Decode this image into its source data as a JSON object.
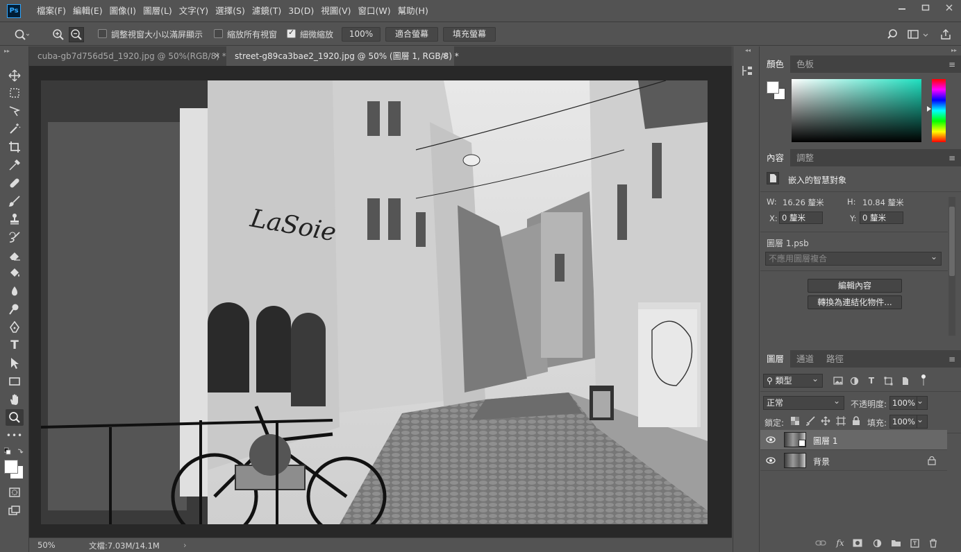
{
  "app": {
    "logo": "Ps"
  },
  "menu": [
    "檔案(F)",
    "編輯(E)",
    "圖像(I)",
    "圖層(L)",
    "文字(Y)",
    "選擇(S)",
    "濾鏡(T)",
    "3D(D)",
    "視圖(V)",
    "窗口(W)",
    "幫助(H)"
  ],
  "options": {
    "fit_window_label": "調整視窗大小以滿屏顯示",
    "zoom_all_label": "縮放所有視窗",
    "scrubby_label": "細微縮放",
    "zoom_value": "100%",
    "fit_screen_label": "適合螢幕",
    "fill_screen_label": "填充螢幕",
    "fit_window_checked": false,
    "zoom_all_checked": false,
    "scrubby_checked": true
  },
  "tabs": [
    {
      "title": "cuba-gb7d756d5d_1920.jpg @ 50%(RGB/8) *",
      "active": false
    },
    {
      "title": "street-g89ca3bae2_1920.jpg @ 50% (圖層 1, RGB/8) *",
      "active": true
    }
  ],
  "status": {
    "zoom": "50%",
    "doc_info": "文檔:7.03M/14.1M"
  },
  "color_panel": {
    "tabs": [
      "顏色",
      "色板"
    ],
    "active_tab": "顏色"
  },
  "properties_panel": {
    "tabs": [
      "內容",
      "調整"
    ],
    "active_tab": "內容",
    "type_label": "嵌入的智慧對象",
    "w_label": "W:",
    "w_value": "16.26 釐米",
    "h_label": "H:",
    "h_value": "10.84 釐米",
    "x_label": "X:",
    "x_value": "0 釐米",
    "y_label": "Y:",
    "y_value": "0 釐米",
    "file_name": "圖層 1.psb",
    "comp_select": "不應用圖層複合",
    "edit_contents": "編輯內容",
    "convert_linked": "轉換為連結化物件..."
  },
  "layers_panel": {
    "tabs": [
      "圖層",
      "通道",
      "路徑"
    ],
    "active_tab": "圖層",
    "filter_kind": "類型",
    "blend_mode": "正常",
    "opacity_label": "不透明度:",
    "opacity_value": "100%",
    "lock_label": "鎖定:",
    "fill_label": "填充:",
    "fill_value": "100%",
    "layers": [
      {
        "name": "圖層 1",
        "selected": true
      },
      {
        "name": "背景",
        "selected": false,
        "locked": true
      }
    ]
  },
  "colors": {
    "accent_ps": "#31a8ff",
    "panel_bg": "#535353",
    "dark_bg": "#282828"
  }
}
